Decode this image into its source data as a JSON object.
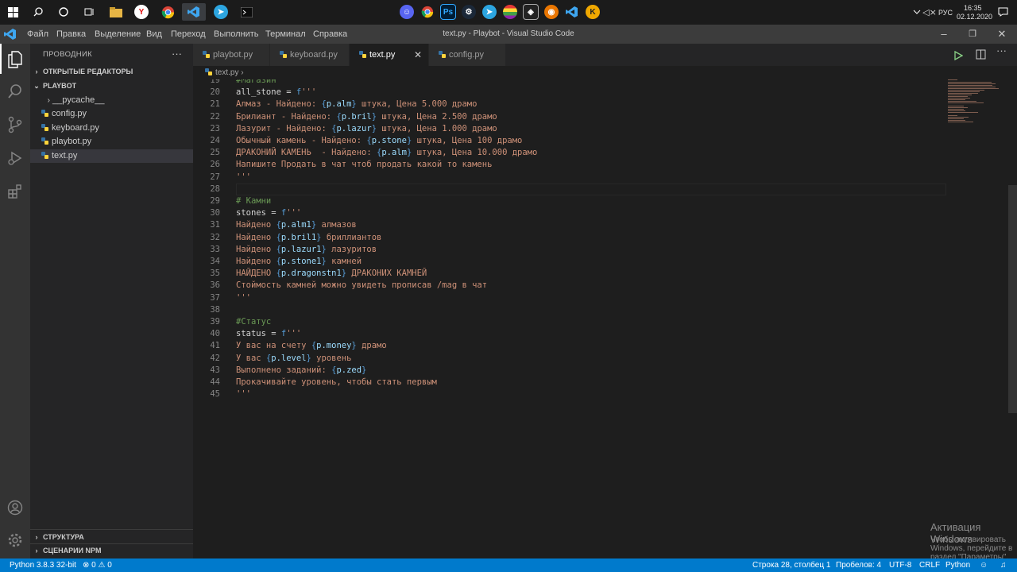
{
  "taskbar": {
    "clock_time": "16:35",
    "clock_date": "02.12.2020",
    "lang": "РУС"
  },
  "titlebar": {
    "menu": [
      "Файл",
      "Правка",
      "Выделение",
      "Вид",
      "Переход",
      "Выполнить",
      "Терминал",
      "Справка"
    ],
    "title": "text.py - Playbot - Visual Studio Code"
  },
  "sidebar": {
    "header": "ПРОВОДНИК",
    "open_editors": "ОТКРЫТЫЕ РЕДАКТОРЫ",
    "project": "PLAYBOT",
    "items": [
      "__pycache__",
      "config.py",
      "keyboard.py",
      "playbot.py",
      "text.py"
    ],
    "outline": "СТРУКТУРА",
    "npm": "СЦЕНАРИИ NPM"
  },
  "tabs": [
    "playbot.py",
    "keyboard.py",
    "text.py",
    "config.py"
  ],
  "breadcrumb": "text.py",
  "editor": {
    "lines": [
      {
        "n": "19",
        "t": "#Магазин"
      },
      {
        "n": "20",
        "t": "all_stone = f'''"
      },
      {
        "n": "21",
        "t": "Алмаз - Найдено: {p.alm} штука, Цена 5.000 драмо"
      },
      {
        "n": "22",
        "t": "Брилиант - Найдено: {p.bril} штука, Цена 2.500 драмо"
      },
      {
        "n": "23",
        "t": "Лазурит - Найдено: {p.lazur} штука, Цена 1.000 драмо"
      },
      {
        "n": "24",
        "t": "Обычный камень - Найдено: {p.stone} штука, Цена 100 драмо"
      },
      {
        "n": "25",
        "t": "ДРАКОНИЙ КАМЕНЬ  - Найдено: {p.alm} штука, Цена 10.000 драмо"
      },
      {
        "n": "26",
        "t": "Напишите Продать в чат чтоб продать какой то камень"
      },
      {
        "n": "27",
        "t": "'''"
      },
      {
        "n": "28",
        "t": ""
      },
      {
        "n": "29",
        "t": "# Камни"
      },
      {
        "n": "30",
        "t": "stones = f'''"
      },
      {
        "n": "31",
        "t": "Найдено {p.alm1} алмазов"
      },
      {
        "n": "32",
        "t": "Найдено {p.bril1} бриллиантов"
      },
      {
        "n": "33",
        "t": "Найдено {p.lazur1} лазуритов"
      },
      {
        "n": "34",
        "t": "Найдено {p.stone1} камней"
      },
      {
        "n": "35",
        "t": "НАЙДЕНО {p.dragonstn1} ДРАКОНИХ КАМНЕЙ"
      },
      {
        "n": "36",
        "t": "Стоймость камней можно увидеть прописав /mag в чат"
      },
      {
        "n": "37",
        "t": "'''"
      },
      {
        "n": "38",
        "t": ""
      },
      {
        "n": "39",
        "t": "#Статус"
      },
      {
        "n": "40",
        "t": "status = f'''"
      },
      {
        "n": "41",
        "t": "У вас на счету {p.money} драмо"
      },
      {
        "n": "42",
        "t": "У вас {p.level} уровень"
      },
      {
        "n": "43",
        "t": "Выполнено заданий: {p.zed}"
      },
      {
        "n": "44",
        "t": "Прокачивайте уровень, чтобы стать первым"
      },
      {
        "n": "45",
        "t": "'''"
      }
    ]
  },
  "watermark": {
    "title": "Активация Windows",
    "subtitle": "Чтобы активировать Windows, перейдите в раздел \"Параметры\"."
  },
  "statusbar": {
    "interpreter": "Python 3.8.3 32-bit",
    "errors": "0",
    "warnings": "0",
    "position": "Строка 28, столбец 1",
    "spaces": "Пробелов: 4",
    "encoding": "UTF-8",
    "eol": "CRLF",
    "language": "Python"
  },
  "colors": {
    "accent": "#007acc",
    "string": "#ce9178",
    "comment": "#6a9955",
    "identifier": "#d4d4d4",
    "interp_brace": "#569cd6",
    "interp_var": "#9cdcfe"
  }
}
